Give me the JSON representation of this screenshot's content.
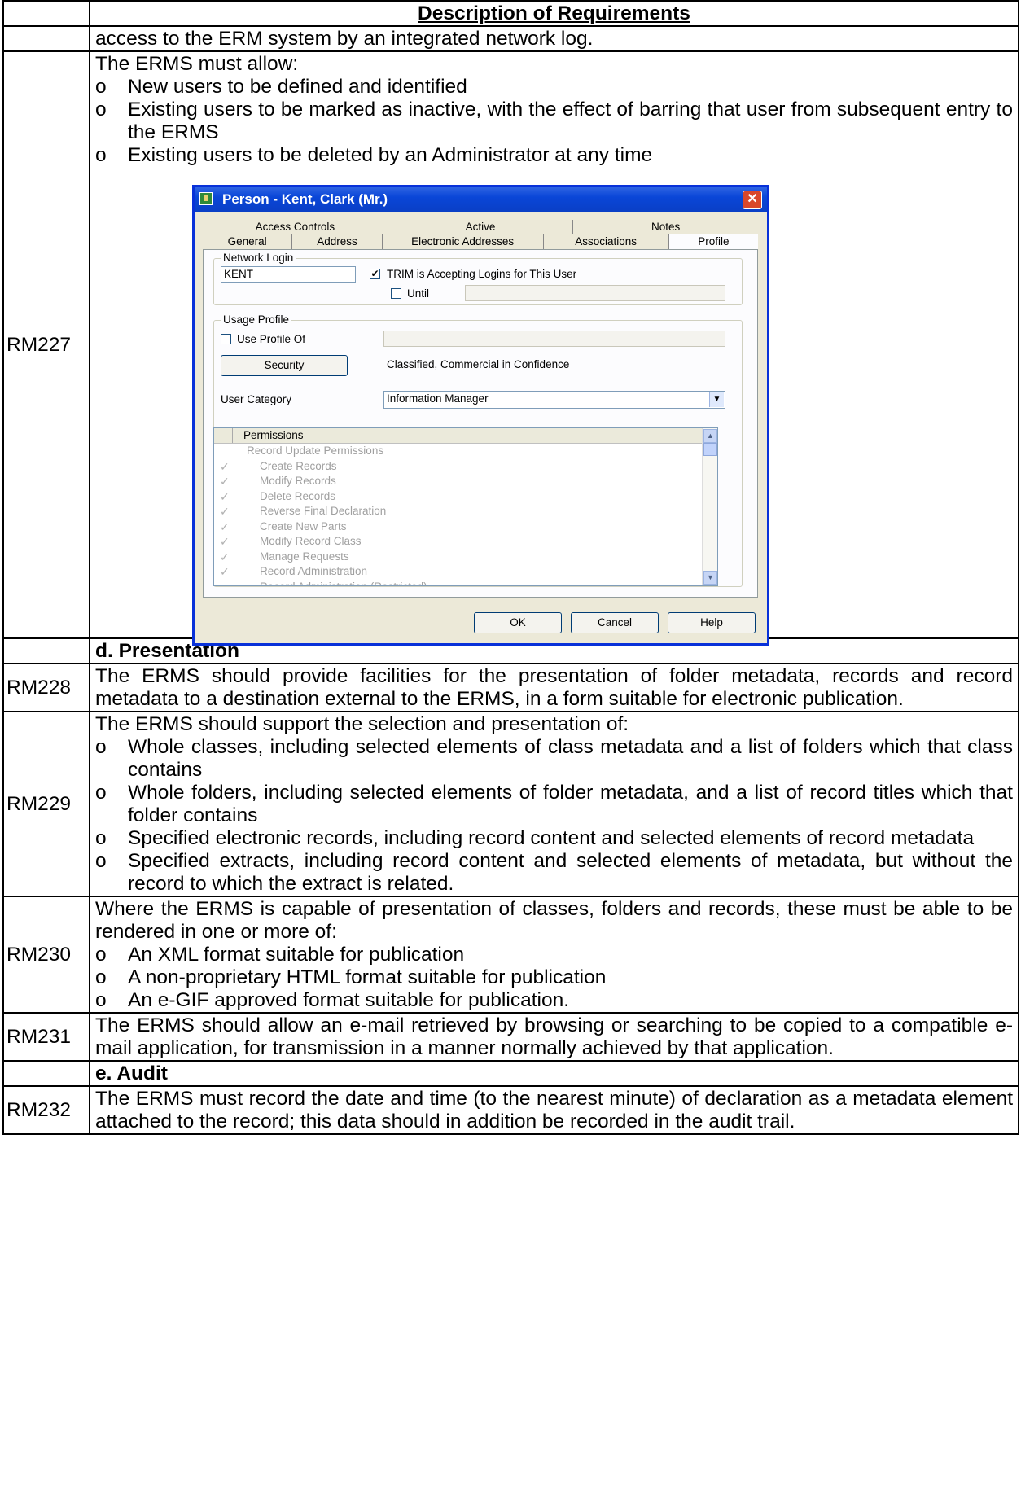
{
  "header": {
    "title": "Description of Requirements"
  },
  "continued_text": "access to the ERM system by an integrated network log.",
  "rm227": {
    "id": "RM227",
    "intro": "The ERMS must allow:",
    "bullets": [
      "New users to be defined and identified",
      "Existing users to be marked as inactive, with the effect of barring that user from subsequent entry to the ERMS",
      "Existing users to be deleted by an Administrator at any time"
    ]
  },
  "bullet_glyph": "o",
  "dialog": {
    "title": "Person - Kent, Clark (Mr.)",
    "close": "✕",
    "tabs_back": [
      "Access Controls",
      "Active",
      "Notes"
    ],
    "tabs_front": [
      "General",
      "Address",
      "Electronic Addresses",
      "Associations",
      "Profile"
    ],
    "network_login_legend": "Network Login",
    "network_login_value": "KENT",
    "accept_check": "✔",
    "accept_label": "TRIM is Accepting Logins for This User",
    "until_label": "Until",
    "usage_profile_legend": "Usage Profile",
    "use_profile_of_label": "Use Profile Of",
    "security_button": "Security",
    "security_value": "Classified, Commercial in Confidence",
    "user_category_label": "User Category",
    "user_category_value": "Information Manager",
    "permissions_header": "Permissions",
    "permissions": [
      {
        "label": "Record Update Permissions",
        "tick": false
      },
      {
        "label": "Create Records",
        "tick": true
      },
      {
        "label": "Modify Records",
        "tick": true
      },
      {
        "label": "Delete Records",
        "tick": true
      },
      {
        "label": "Reverse Final Declaration",
        "tick": true
      },
      {
        "label": "Create New Parts",
        "tick": true
      },
      {
        "label": "Modify Record Class",
        "tick": true
      },
      {
        "label": "Manage Requests",
        "tick": true
      },
      {
        "label": "Record Administration",
        "tick": true
      },
      {
        "label": "Record Administration (Restricted)",
        "tick": false
      }
    ],
    "ok": "OK",
    "cancel": "Cancel",
    "help": "Help"
  },
  "section_d": "d. Presentation",
  "rm228": {
    "id": "RM228",
    "text": "The ERMS should provide facilities for the presentation of folder metadata, records and record metadata to a destination external to the ERMS, in a form suitable for electronic publication."
  },
  "rm229": {
    "id": "RM229",
    "intro": "The ERMS should support the selection and presentation of:",
    "bullets": [
      "Whole classes, including selected elements of class metadata and a list of folders which that class contains",
      "Whole folders, including selected elements of folder metadata, and a list of record titles which that folder contains",
      "Specified electronic records, including record content and selected elements of record metadata",
      "Specified extracts, including record content and selected elements of metadata, but without the record to which the extract is related."
    ]
  },
  "rm230": {
    "id": "RM230",
    "intro": "Where the ERMS is capable of presentation of classes, folders and records, these must be able to be rendered in one or more of:",
    "bullets": [
      "An XML format suitable for publication",
      "A non-proprietary HTML format suitable for publication",
      "An e-GIF approved format suitable for publication."
    ]
  },
  "rm231": {
    "id": "RM231",
    "text": "The ERMS should allow an e-mail retrieved by browsing or searching to be copied to a compatible e-mail application, for transmission in a manner normally achieved by that application."
  },
  "section_e": "e. Audit",
  "rm232": {
    "id": "RM232",
    "text": "The ERMS must record the date and time (to the nearest minute) of declaration as a metadata element attached to the record; this data should in addition be recorded in the audit trail."
  }
}
